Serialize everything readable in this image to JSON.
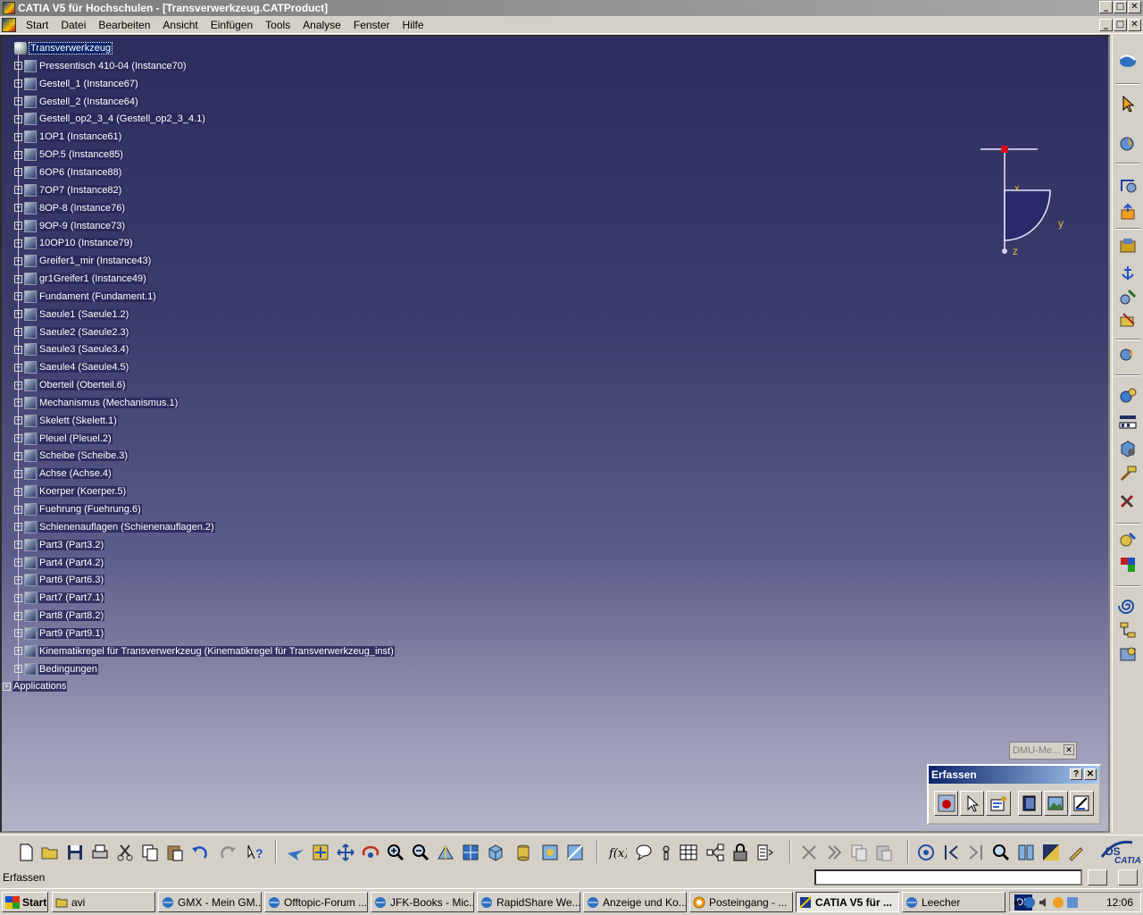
{
  "window": {
    "title": "CATIA V5 für Hochschulen - [Transverwerkzeug.CATProduct]",
    "controls": [
      "_",
      "□",
      "✕"
    ]
  },
  "menu": {
    "items": [
      "Start",
      "Datei",
      "Bearbeiten",
      "Ansicht",
      "Einfügen",
      "Tools",
      "Analyse",
      "Fenster",
      "Hilfe"
    ],
    "controls": [
      "_",
      "□",
      "✕"
    ]
  },
  "tree": {
    "root": "Transverwerkzeug",
    "children": [
      "Pressentisch 410-04 (Instance70)",
      "Gestell_1 (Instance67)",
      "Gestell_2 (Instance64)",
      "Gestell_op2_3_4 (Gestell_op2_3_4.1)",
      "1OP1 (Instance61)",
      "5OP.5 (Instance85)",
      "6OP6 (Instance88)",
      "7OP7 (Instance82)",
      "8OP-8 (Instance76)",
      "9OP-9 (Instance73)",
      "10OP10 (Instance79)",
      "Greifer1_mir (Instance43)",
      "gr1Greifer1 (Instance49)",
      "Fundament (Fundament.1)",
      "Saeule1 (Saeule1.2)",
      "Saeule2 (Saeule2.3)",
      "Saeule3 (Saeule3.4)",
      "Saeule4 (Saeule4.5)",
      "Oberteil (Oberteil.6)",
      "Mechanismus (Mechanismus.1)",
      "Skelett (Skelett.1)",
      "Pleuel (Pleuel.2)",
      "Scheibe (Scheibe.3)",
      "Achse (Achse.4)",
      "Koerper (Koerper.5)",
      "Fuehrung (Fuehrung.6)",
      "Schienenauflagen (Schienenauflagen.2)",
      "Part3 (Part3.2)",
      "Part4 (Part4.2)",
      "Part6 (Part6.3)",
      "Part7 (Part7.1)",
      "Part8 (Part8.2)",
      "Part9 (Part9.1)",
      "Kinematikregel für Transverwerkzeug (Kinematikregel für Transverwerkzeug_inst)",
      "Bedingungen"
    ],
    "applications": "Applications"
  },
  "compass": {
    "x_label": "x",
    "y_label": "y",
    "z_label": "z"
  },
  "dmu_panel": {
    "title": "DMU-Me..."
  },
  "erfassen_panel": {
    "title": "Erfassen",
    "help": "?",
    "close": "✕",
    "tools": [
      "record-icon",
      "select-icon",
      "capture-settings-icon",
      "album-icon",
      "image-icon",
      "measure-icon"
    ]
  },
  "status": {
    "text": "Erfassen",
    "command_placeholder": ""
  },
  "taskbar": {
    "start": "Start",
    "tasks": [
      {
        "label": "avi",
        "active": false
      },
      {
        "label": "GMX - Mein GM...",
        "active": false
      },
      {
        "label": "Offtopic-Forum ...",
        "active": false
      },
      {
        "label": "JFK-Books - Mic...",
        "active": false
      },
      {
        "label": "RapidShare We...",
        "active": false
      },
      {
        "label": "Anzeige und Ko...",
        "active": false
      },
      {
        "label": "Posteingang - ...",
        "active": false
      },
      {
        "label": "CATIA V5 für ...",
        "active": true
      },
      {
        "label": "Leecher",
        "active": false
      }
    ],
    "language": "DE",
    "clock": "12:06"
  },
  "colors": {
    "selection": "#0a246a",
    "viewport_top": "#2e2e5e",
    "viewport_bottom": "#b4b4c8",
    "compass_marker": "#d01020",
    "axis_label": "#e0c040"
  }
}
